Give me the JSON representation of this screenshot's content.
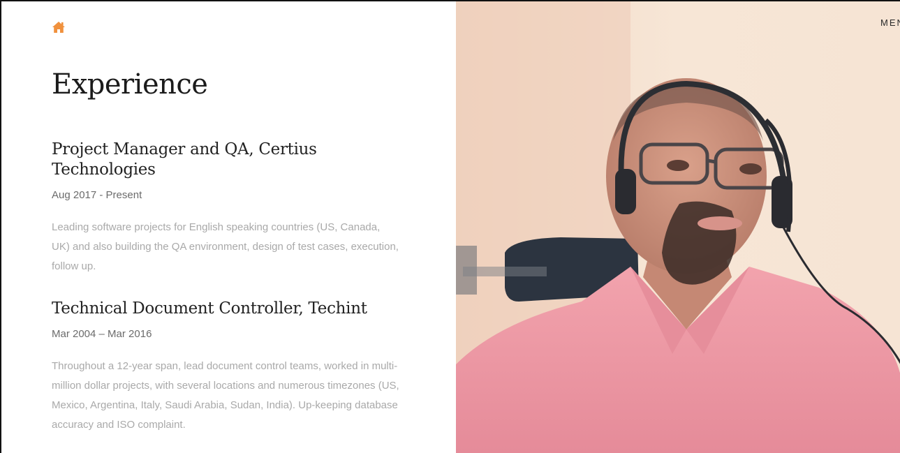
{
  "page": {
    "title": "Experience",
    "menu_label": "MENU"
  },
  "icons": {
    "home": "home-icon"
  },
  "colors": {
    "accent": "#f0913d",
    "title": "#1b1b1b",
    "date": "#6b6b6b",
    "description": "#a9a9a9"
  },
  "experience": [
    {
      "title": "Project Manager and QA, Certius Technologies",
      "date": "Aug 2017 - Present",
      "description": "Leading software projects for English speaking countries (US, Canada, UK) and also building the QA environment, design of test cases, execution, follow up."
    },
    {
      "title": "Technical Document Controller, Techint",
      "date": "Mar 2004 – Mar 2016",
      "description": "Throughout a 12-year span, lead document control teams, worked in multi-million dollar projects, with several locations and numerous timezones (US, Mexico, Argentina, Italy, Saudi Arabia, Sudan, India). Up-keeping database accuracy and ISO complaint."
    }
  ]
}
